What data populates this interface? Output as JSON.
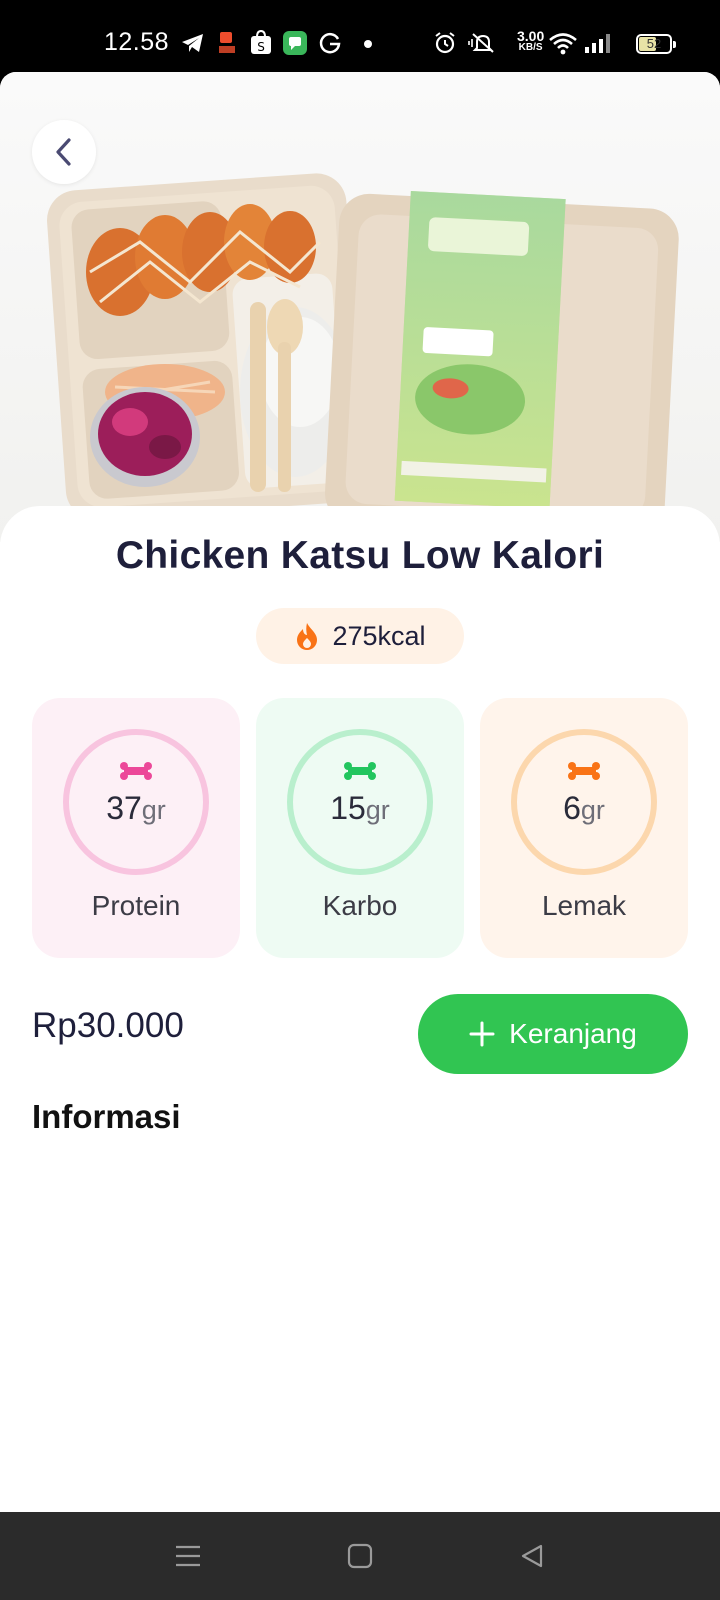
{
  "status_bar": {
    "time": "12.58",
    "net_speed_value": "3.00",
    "net_speed_unit": "KB/S",
    "battery_level": "52",
    "battery_fraction": 0.52
  },
  "product": {
    "name": "Chicken Katsu Low Kalori",
    "calories": "275kcal",
    "price": "Rp30.000",
    "image_icon": "food-photo"
  },
  "macros": [
    {
      "value": "37",
      "unit": "gr",
      "label": "Protein",
      "color": "#ec4899"
    },
    {
      "value": "15",
      "unit": "gr",
      "label": "Karbo",
      "color": "#22c55e"
    },
    {
      "value": "6",
      "unit": "gr",
      "label": "Lemak",
      "color": "#f97316"
    }
  ],
  "actions": {
    "add_to_cart_label": "Keranjang"
  },
  "section": {
    "info_heading": "Informasi"
  },
  "colors": {
    "accent_green": "#31c552",
    "title_text": "#1e1f3b",
    "calorie_flame": "#f97316"
  }
}
